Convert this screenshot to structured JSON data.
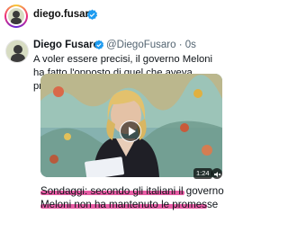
{
  "header": {
    "username": "diego.fusaro"
  },
  "tweet": {
    "name": "Diego Fusaro",
    "handle": "@DiegoFusaro · 0s",
    "text": "A voler essere precisi, il governo Meloni ha fatto l'opposto di quel che aveva promesso..."
  },
  "video": {
    "duration": "1:24"
  },
  "headline": "Sondaggi: secondo gli italiani il governo Meloni non ha mantenuto le promesse",
  "colors": {
    "verified": "#1d9bf0",
    "highlight": "#e64b9b"
  }
}
